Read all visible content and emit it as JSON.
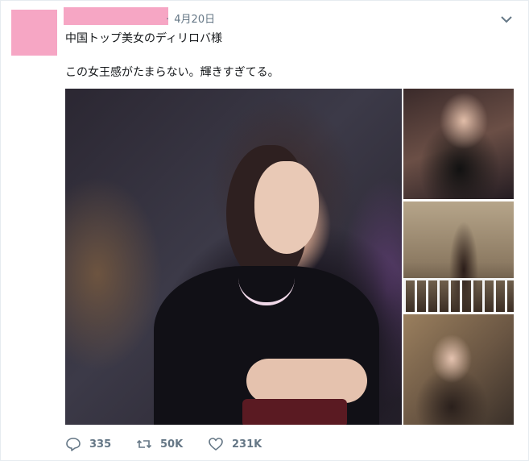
{
  "tweet": {
    "date": "4月20日",
    "date_separator": "·",
    "text_line1": "中国トップ美女のディリロバ様",
    "text_line2": "この女王感がたまらない。輝きすぎてる。",
    "media": {
      "photos": [
        {
          "label": "main-photo"
        },
        {
          "label": "photo-2"
        },
        {
          "label": "photo-3"
        },
        {
          "label": "photo-4"
        }
      ]
    },
    "actions": {
      "reply_count": "335",
      "retweet_count": "50K",
      "like_count": "231K"
    }
  },
  "colors": {
    "redaction": "#f6a6c4",
    "muted": "#657786",
    "border": "#e6ecf0"
  },
  "icons": [
    "chevron-down-icon",
    "reply-icon",
    "retweet-icon",
    "like-icon"
  ]
}
